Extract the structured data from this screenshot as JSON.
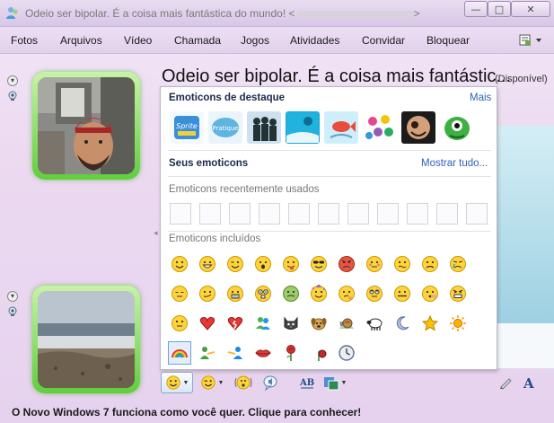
{
  "window": {
    "title": "Odeio ser bipolar. É a coisa mais fantástica do mundo! <",
    "title_suffix": ">",
    "minimize_glyph": "—",
    "maximize_glyph": "□",
    "close_glyph": "✕"
  },
  "menu": {
    "items": [
      "Fotos",
      "Arquivos",
      "Vídeo",
      "Chamada",
      "Jogos",
      "Atividades",
      "Convidar",
      "Bloquear"
    ],
    "options_icon": "show-menu-icon"
  },
  "conversation": {
    "contact_name": "Odeio ser bipolar. É a coisa mais fantástic...",
    "status": "(Disponível)"
  },
  "emoticons_popup": {
    "featured_title": "Emoticons de destaque",
    "featured_more": "Mais",
    "featured_items": [
      "sprite-wink",
      "pratique-wink",
      "silhouettes-wink",
      "cyan-scene-wink",
      "fish-wink",
      "flowers-wink",
      "dancer-wink",
      "green-monster-wink"
    ],
    "my_title": "Seus emoticons",
    "my_show_all": "Mostrar tudo...",
    "recent_title": "Emoticons recentemente usados",
    "recent_slots": 11,
    "included_title": "Emoticons incluídos",
    "included": [
      "smile",
      "grin",
      "wink",
      "surprised",
      "tongue",
      "cool",
      "angry",
      "embarrassed",
      "confused",
      "sad",
      "crying",
      "disappointed",
      "sarcastic",
      "teeth",
      "nerd",
      "sick",
      "party",
      "thinking",
      "eye-roll",
      "zipped-mouth",
      "secret",
      "baring-teeth",
      "i-dont-know",
      "red-heart",
      "broken-heart",
      "messenger-buddies",
      "cat-face",
      "dog-face",
      "snail",
      "black-sheep",
      "moon",
      "star",
      "sun",
      "rainbow",
      "hug-left",
      "hug-right",
      "red-lips",
      "red-rose",
      "wilted-rose",
      "clock"
    ]
  },
  "toolbar": {
    "items": [
      "emoticon-button",
      "wink-button",
      "nudge-button",
      "voice-clip-button",
      "font-button",
      "background-button"
    ]
  },
  "ad": {
    "text": "O Novo Windows 7 funciona como você quer. Clique para conhecer!"
  },
  "colors": {
    "accent_green": "#5fcf3c",
    "link_blue": "#2d63b8",
    "header_navy": "#1c2a4b"
  }
}
